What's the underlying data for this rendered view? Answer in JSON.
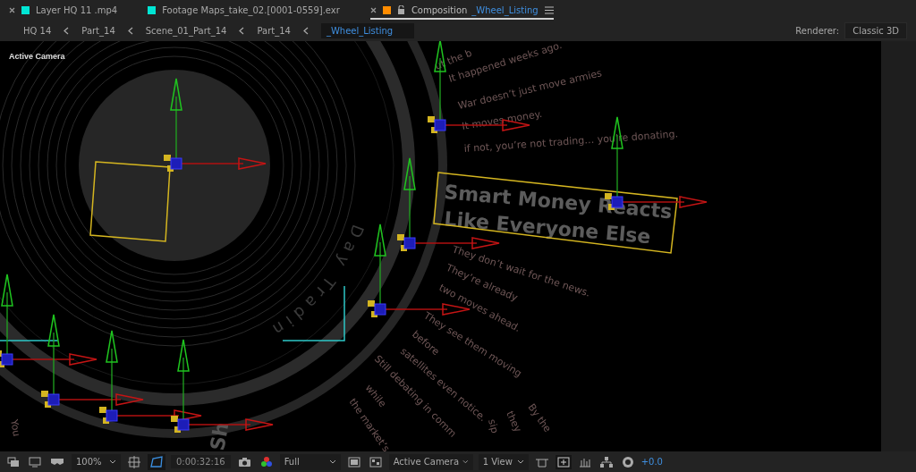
{
  "tabs": [
    {
      "kind": "layer",
      "label": "Layer  HQ 11 .mp4",
      "color": "#00e5d4",
      "selected": false,
      "closable": true
    },
    {
      "kind": "footage",
      "label": "Footage  Maps_take_02.[0001-0559].exr",
      "color": "#00e5d4",
      "selected": false,
      "closable": false
    },
    {
      "kind": "composition",
      "label": "Composition",
      "name": "_Wheel_Listing",
      "color": "#ff8c00",
      "selected": true,
      "closable": true
    }
  ],
  "breadcrumbs": [
    {
      "label": "HQ 14",
      "selected": false
    },
    {
      "label": "Part_14",
      "selected": false
    },
    {
      "label": "Scene_01_Part_14",
      "selected": false
    },
    {
      "label": "Part_14",
      "selected": false
    },
    {
      "label": "_Wheel_Listing",
      "selected": true
    }
  ],
  "renderer": {
    "label": "Renderer:",
    "value": "Classic 3D"
  },
  "viewer": {
    "view_label": "Active Camera",
    "ring_text": "Day Tradin",
    "title_lines": [
      "Smart Money Reacts",
      "Like Everyone Else"
    ],
    "caption_lines": [
      "ut the b",
      "It happened weeks ago.",
      "War doesn’t just move armies",
      "It moves money.",
      "if not, you’re not trading… you’re donating.",
      "They don’t wait for the news.",
      "They’re already",
      "two moves ahead.",
      "They see them moving",
      "before",
      "satellites even notice.",
      "Still debating in comm",
      "while",
      "the market’s",
      "By the",
      "they",
      "sip",
      "You"
    ],
    "fragments": [
      "Sh"
    ]
  },
  "toolbar": {
    "zoom": "100%",
    "timecode": "0:00:32:16",
    "resolution": "Full",
    "view": "Active Camera",
    "layout": "1 View",
    "exposure": "+0.0"
  }
}
